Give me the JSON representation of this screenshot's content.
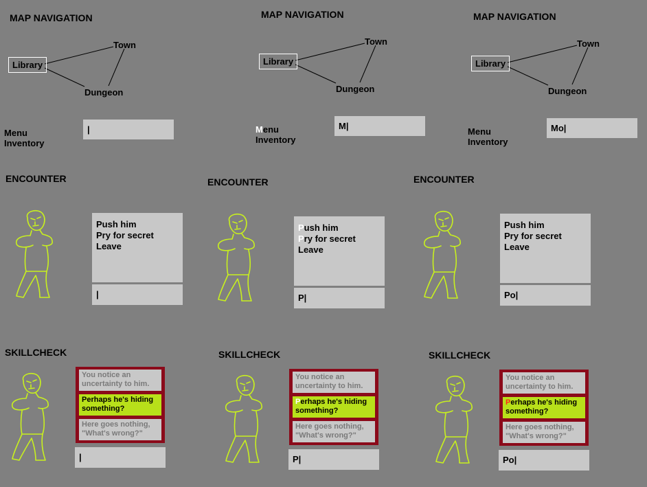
{
  "headings": {
    "map": "MAP NAVIGATION",
    "encounter": "ENCOUNTER",
    "skillcheck": "SKILLCHECK"
  },
  "map": {
    "nodes": {
      "library": "Library",
      "town": "Town",
      "dungeon": "Dungeon"
    },
    "menu_items": [
      "Menu",
      "Inventory"
    ]
  },
  "encounter": {
    "options": [
      "Push him",
      "Pry for secret",
      "Leave"
    ]
  },
  "skillcheck": {
    "options": [
      "You notice an uncertainty to him.",
      "Perhaps he's hiding something?",
      "Here goes nothing, \"What's wrong?\""
    ]
  },
  "frames": [
    {
      "typed": "",
      "highlight_initial": ""
    },
    {
      "typed": "M",
      "highlight_initial": "white"
    },
    {
      "typed": "Mo",
      "highlight_initial": ""
    }
  ],
  "encounter_frames": [
    {
      "typed": "",
      "highlight_initial": ""
    },
    {
      "typed": "P",
      "highlight_initial": "white"
    },
    {
      "typed": "Po",
      "highlight_initial": ""
    }
  ],
  "skill_frames": [
    {
      "typed": "",
      "highlight_initial": ""
    },
    {
      "typed": "P",
      "highlight_initial": "white"
    },
    {
      "typed": "Po",
      "highlight_initial": "red"
    }
  ],
  "colors": {
    "background": "#808080",
    "figure_stroke": "#c8f01e",
    "skill_frame": "#8b0a1a",
    "selected_option": "#b8e01a",
    "input_bg": "#c8c8c8"
  }
}
